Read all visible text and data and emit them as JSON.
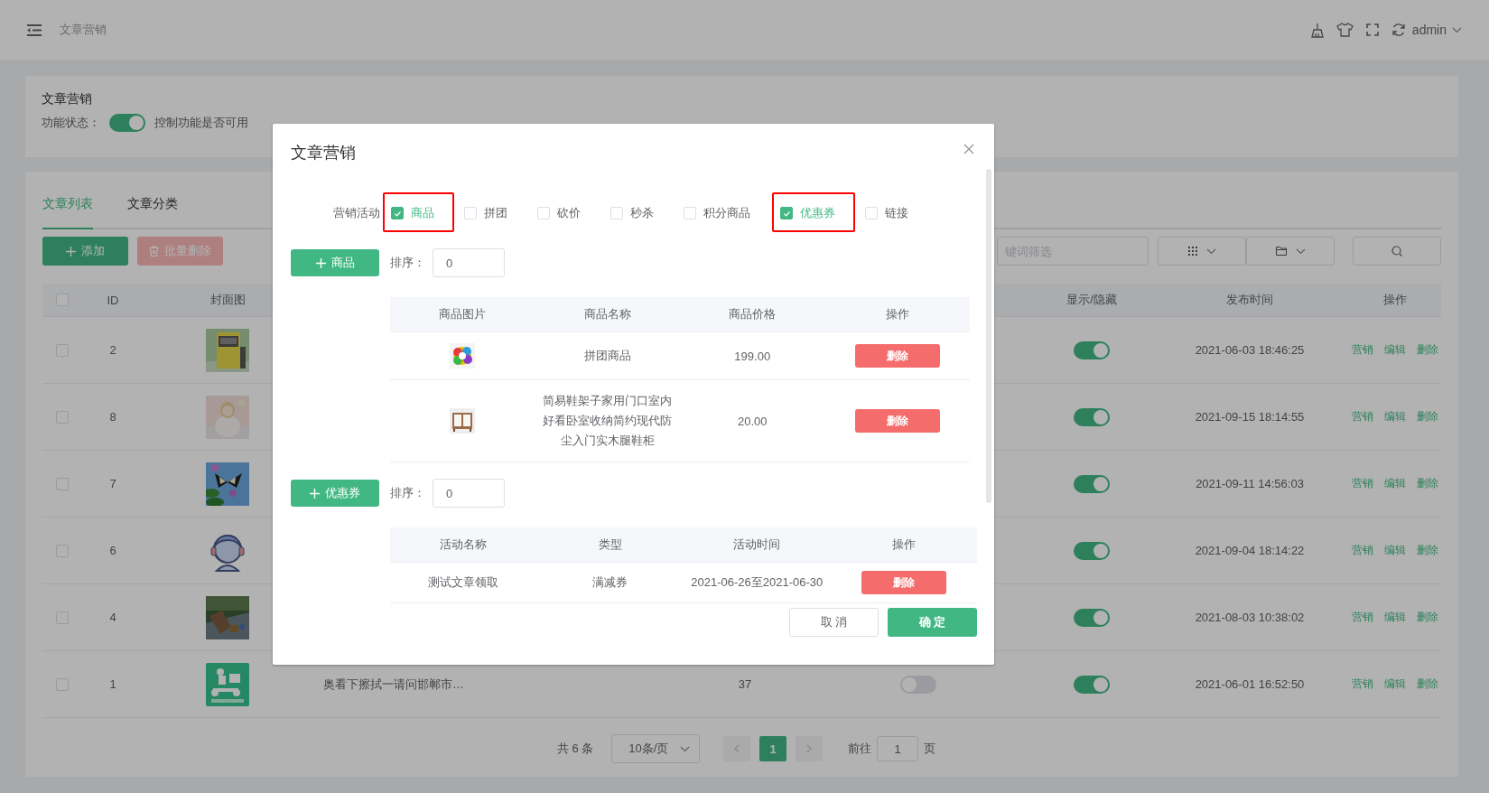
{
  "header": {
    "breadcrumb": "文章营销",
    "user": "admin"
  },
  "feature": {
    "title": "文章营销",
    "label": "功能状态：",
    "on": true,
    "hint": "控制功能是否可用"
  },
  "tabs": [
    {
      "label": "文章列表",
      "selected": true
    },
    {
      "label": "文章分类",
      "selected": false
    }
  ],
  "toolbar": {
    "add_label": "添加",
    "delete_label": "批量删除",
    "delete_disabled": true,
    "search_placeholder": "键词筛选"
  },
  "table": {
    "all_checked": false,
    "columns": [
      "ID",
      "封面图",
      "显示/隐藏",
      "发布时间",
      "操作"
    ],
    "rows": [
      {
        "checked": false,
        "id": "2",
        "cover": {
          "kind": "picture"
        },
        "shown": true,
        "published": "2021-06-03 18:46:25",
        "actions": [
          "营销",
          "编辑",
          "删除"
        ]
      },
      {
        "checked": false,
        "id": "8",
        "cover": {
          "kind": "picture"
        },
        "shown": true,
        "published": "2021-09-15 18:14:55",
        "actions": [
          "营销",
          "编辑",
          "删除"
        ]
      },
      {
        "checked": false,
        "id": "7",
        "cover": {
          "kind": "picture"
        },
        "shown": true,
        "published": "2021-09-11 14:56:03",
        "actions": [
          "营销",
          "编辑",
          "删除"
        ]
      },
      {
        "checked": false,
        "id": "6",
        "cover": {
          "kind": "picture"
        },
        "shown": true,
        "published": "2021-09-04 18:14:22",
        "actions": [
          "营销",
          "编辑",
          "删除"
        ]
      },
      {
        "checked": false,
        "id": "4",
        "cover": {
          "kind": "picture"
        },
        "shown": true,
        "published": "2021-08-03 10:38:02",
        "actions": [
          "营销",
          "编辑",
          "删除"
        ]
      },
      {
        "checked": false,
        "id": "1",
        "cover": {
          "kind": "picture"
        },
        "title": "奥看下擦拭一请问邯郸市…",
        "column_5": "37",
        "column_6_on": false,
        "shown": true,
        "published": "2021-06-01 16:52:50",
        "actions": [
          "营销",
          "编辑",
          "删除"
        ]
      }
    ]
  },
  "pagination": {
    "total": "共 6 条",
    "page_size": "10条/页",
    "pages": [
      {
        "label": "1",
        "selected": true
      }
    ],
    "goto_label": "前往",
    "goto_value": "1",
    "page_suffix": "页"
  },
  "dialog": {
    "title": "文章营销",
    "activity_label": "营销活动",
    "options": [
      {
        "label": "商品",
        "checked": true,
        "highlighted": true
      },
      {
        "label": "拼团",
        "checked": false,
        "highlighted": false
      },
      {
        "label": "砍价",
        "checked": false,
        "highlighted": false
      },
      {
        "label": "秒杀",
        "checked": false,
        "highlighted": false
      },
      {
        "label": "积分商品",
        "checked": false,
        "highlighted": false
      },
      {
        "label": "优惠券",
        "checked": true,
        "highlighted": true
      },
      {
        "label": "链接",
        "checked": false,
        "highlighted": false
      }
    ],
    "goods": {
      "add_label": "商品",
      "sort_label": "排序：",
      "sort_value": "0",
      "columns": [
        "商品图片",
        "商品名称",
        "商品价格",
        "操作"
      ],
      "rows": [
        {
          "image": {
            "kind": "picture"
          },
          "name": "拼团商品",
          "price": "199.00",
          "action": "删除"
        },
        {
          "image": {
            "kind": "picture"
          },
          "name": "简易鞋架子家用门口室内好看卧室收纳简约现代防尘入门实木腿鞋柜",
          "price": "20.00",
          "action": "删除"
        }
      ]
    },
    "coupons": {
      "add_label": "优惠券",
      "sort_label": "排序：",
      "sort_value": "0",
      "columns": [
        "活动名称",
        "类型",
        "活动时间",
        "操作"
      ],
      "rows": [
        {
          "name": "测试文章领取",
          "type": "满减券",
          "period": "2021-06-26至2021-06-30",
          "action": "删除"
        }
      ]
    },
    "cancel_label": "取 消",
    "confirm_label": "确 定"
  }
}
